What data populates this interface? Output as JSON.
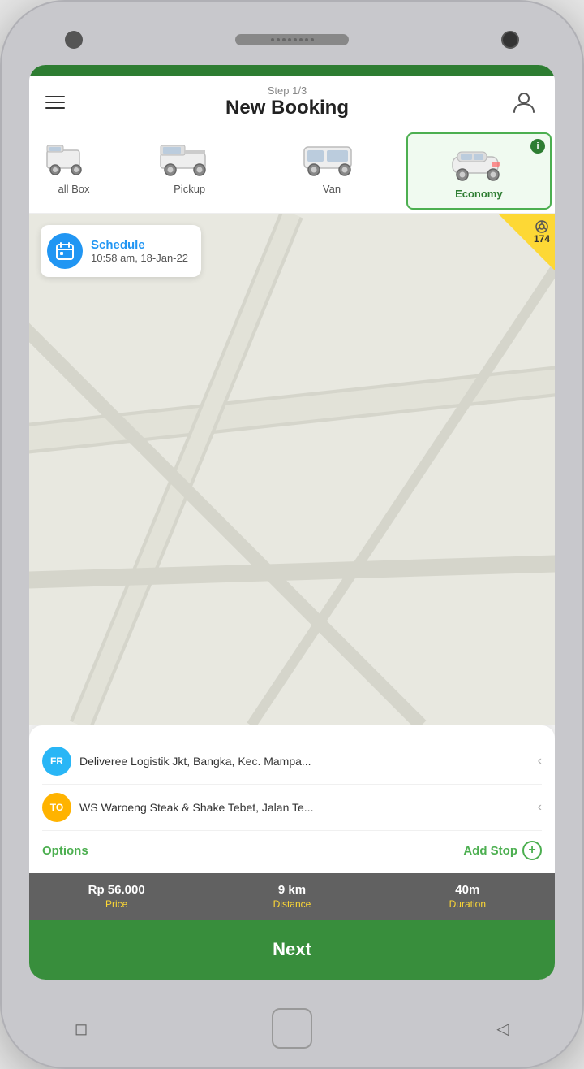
{
  "app": {
    "green_bar_color": "#2e7d32",
    "header": {
      "step_label": "Step 1/3",
      "title": "New Booking"
    }
  },
  "vehicles": [
    {
      "id": "small-box",
      "label": "all Box",
      "active": false
    },
    {
      "id": "pickup",
      "label": "Pickup",
      "active": false
    },
    {
      "id": "van",
      "label": "Van",
      "active": false
    },
    {
      "id": "economy",
      "label": "Economy",
      "active": true
    }
  ],
  "schedule": {
    "title": "Schedule",
    "datetime": "10:58 am, 18-Jan-22"
  },
  "driver_badge": {
    "count": "174"
  },
  "locations": {
    "from": {
      "badge": "FR",
      "text": "Deliveree Logistik Jkt, Bangka, Kec. Mampa..."
    },
    "to": {
      "badge": "TO",
      "text": "WS Waroeng Steak & Shake Tebet, Jalan Te..."
    }
  },
  "actions": {
    "options_label": "Options",
    "add_stop_label": "Add Stop"
  },
  "stats": [
    {
      "value": "Rp 56.000",
      "label": "Price"
    },
    {
      "value": "9 km",
      "label": "Distance"
    },
    {
      "value": "40m",
      "label": "Duration"
    }
  ],
  "next_button": {
    "label": "Next"
  },
  "nav": {
    "back": "◁",
    "home": "",
    "recent": "□"
  }
}
